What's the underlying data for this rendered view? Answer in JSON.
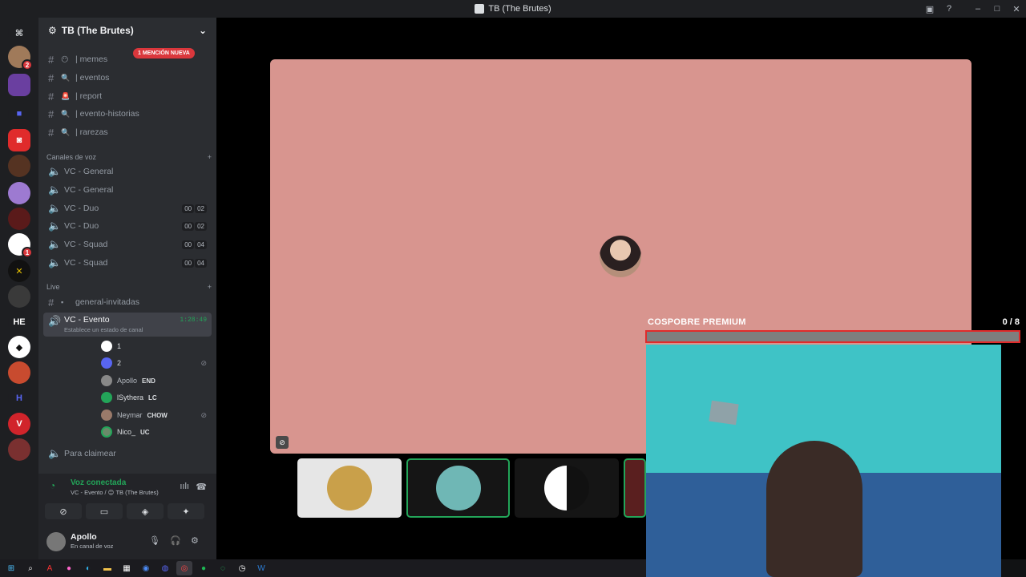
{
  "window": {
    "title": "TB (The Brutes)"
  },
  "rail": {
    "servers": [
      {
        "name": "discord-home",
        "badge": ""
      },
      {
        "name": "server-dog",
        "badge": "2"
      },
      {
        "name": "server-purple",
        "badge": ""
      },
      {
        "name": "server-blue-dot",
        "badge": ""
      },
      {
        "name": "server-red",
        "badge": ""
      },
      {
        "name": "server-dark",
        "badge": ""
      },
      {
        "name": "server-anime",
        "badge": ""
      },
      {
        "name": "server-red-figure",
        "badge": ""
      },
      {
        "name": "server-numbered",
        "badge": "1"
      },
      {
        "name": "server-x",
        "badge": ""
      },
      {
        "name": "server-landscape",
        "badge": ""
      },
      {
        "name": "server-he",
        "label": "HE",
        "badge": ""
      },
      {
        "name": "server-diamond",
        "badge": ""
      },
      {
        "name": "server-colorful",
        "badge": ""
      },
      {
        "name": "server-h",
        "label": "H",
        "badge": ""
      },
      {
        "name": "server-v",
        "label": "V",
        "badge": ""
      },
      {
        "name": "server-girl",
        "badge": ""
      }
    ]
  },
  "sidebar": {
    "guild_name": "TB (The Brutes)",
    "mention_label": "1 MENCIÓN NUEVA",
    "text_channels": [
      {
        "emoji": "😶",
        "name": "| memes"
      },
      {
        "emoji": "🔍",
        "name": "| eventos"
      },
      {
        "emoji": "🚨",
        "name": "| report"
      },
      {
        "emoji": "🔍",
        "name": "| evento-historias"
      },
      {
        "emoji": "🔍",
        "name": "| rarezas"
      }
    ],
    "voice_category": "Canales de voz",
    "voice_channels": [
      {
        "name": "VC - General",
        "a": "",
        "b": ""
      },
      {
        "name": "VC - General",
        "a": "",
        "b": ""
      },
      {
        "name": "VC - Duo",
        "a": "00",
        "b": "02"
      },
      {
        "name": "VC - Duo",
        "a": "00",
        "b": "02"
      },
      {
        "name": "VC - Squad",
        "a": "00",
        "b": "04"
      },
      {
        "name": "VC - Squad",
        "a": "00",
        "b": "04"
      }
    ],
    "live_category": "Live",
    "live_text_channel": "general-invitadas",
    "active_voice": {
      "name": "VC - Evento",
      "timer": "1:28:49",
      "status_hint": "Establece un estado de canal"
    },
    "members": [
      {
        "name": "1",
        "tag": "",
        "muted": false
      },
      {
        "name": "2",
        "tag": "",
        "muted": true
      },
      {
        "name": "Apollo",
        "tag": "END",
        "muted": false
      },
      {
        "name": "lSythera",
        "tag": "LC",
        "muted": false
      },
      {
        "name": "Neymar",
        "tag": "CHOW",
        "muted": true
      },
      {
        "name": "Nico_",
        "tag": "UC",
        "muted": false
      }
    ],
    "claim_channel": "Para claimear"
  },
  "voice_panel": {
    "status": "Voz conectada",
    "location": "VC - Evento / 😊 TB (The Brutes)"
  },
  "user_panel": {
    "name": "Apollo",
    "status": "En canal de voz"
  },
  "overlay": {
    "title": "COSPOBRE PREMIUM",
    "current": "0",
    "total": "/ 8",
    "progress_fraction": 0
  },
  "colors": {
    "stage_bg": "#d8958f",
    "speaking_green": "#23a559",
    "mention_red": "#da373c",
    "progress_red": "#e02b2b",
    "webcam_wall": "#3fc3c6"
  },
  "taskbar": {
    "icons": [
      "start-icon",
      "search-icon",
      "adobe-icon",
      "color-icon",
      "edge-icon",
      "files-icon",
      "store-icon",
      "browser-icon",
      "discord-icon",
      "chrome-icon",
      "spotify-icon",
      "whatsapp-icon",
      "clock-icon",
      "word-icon"
    ]
  }
}
